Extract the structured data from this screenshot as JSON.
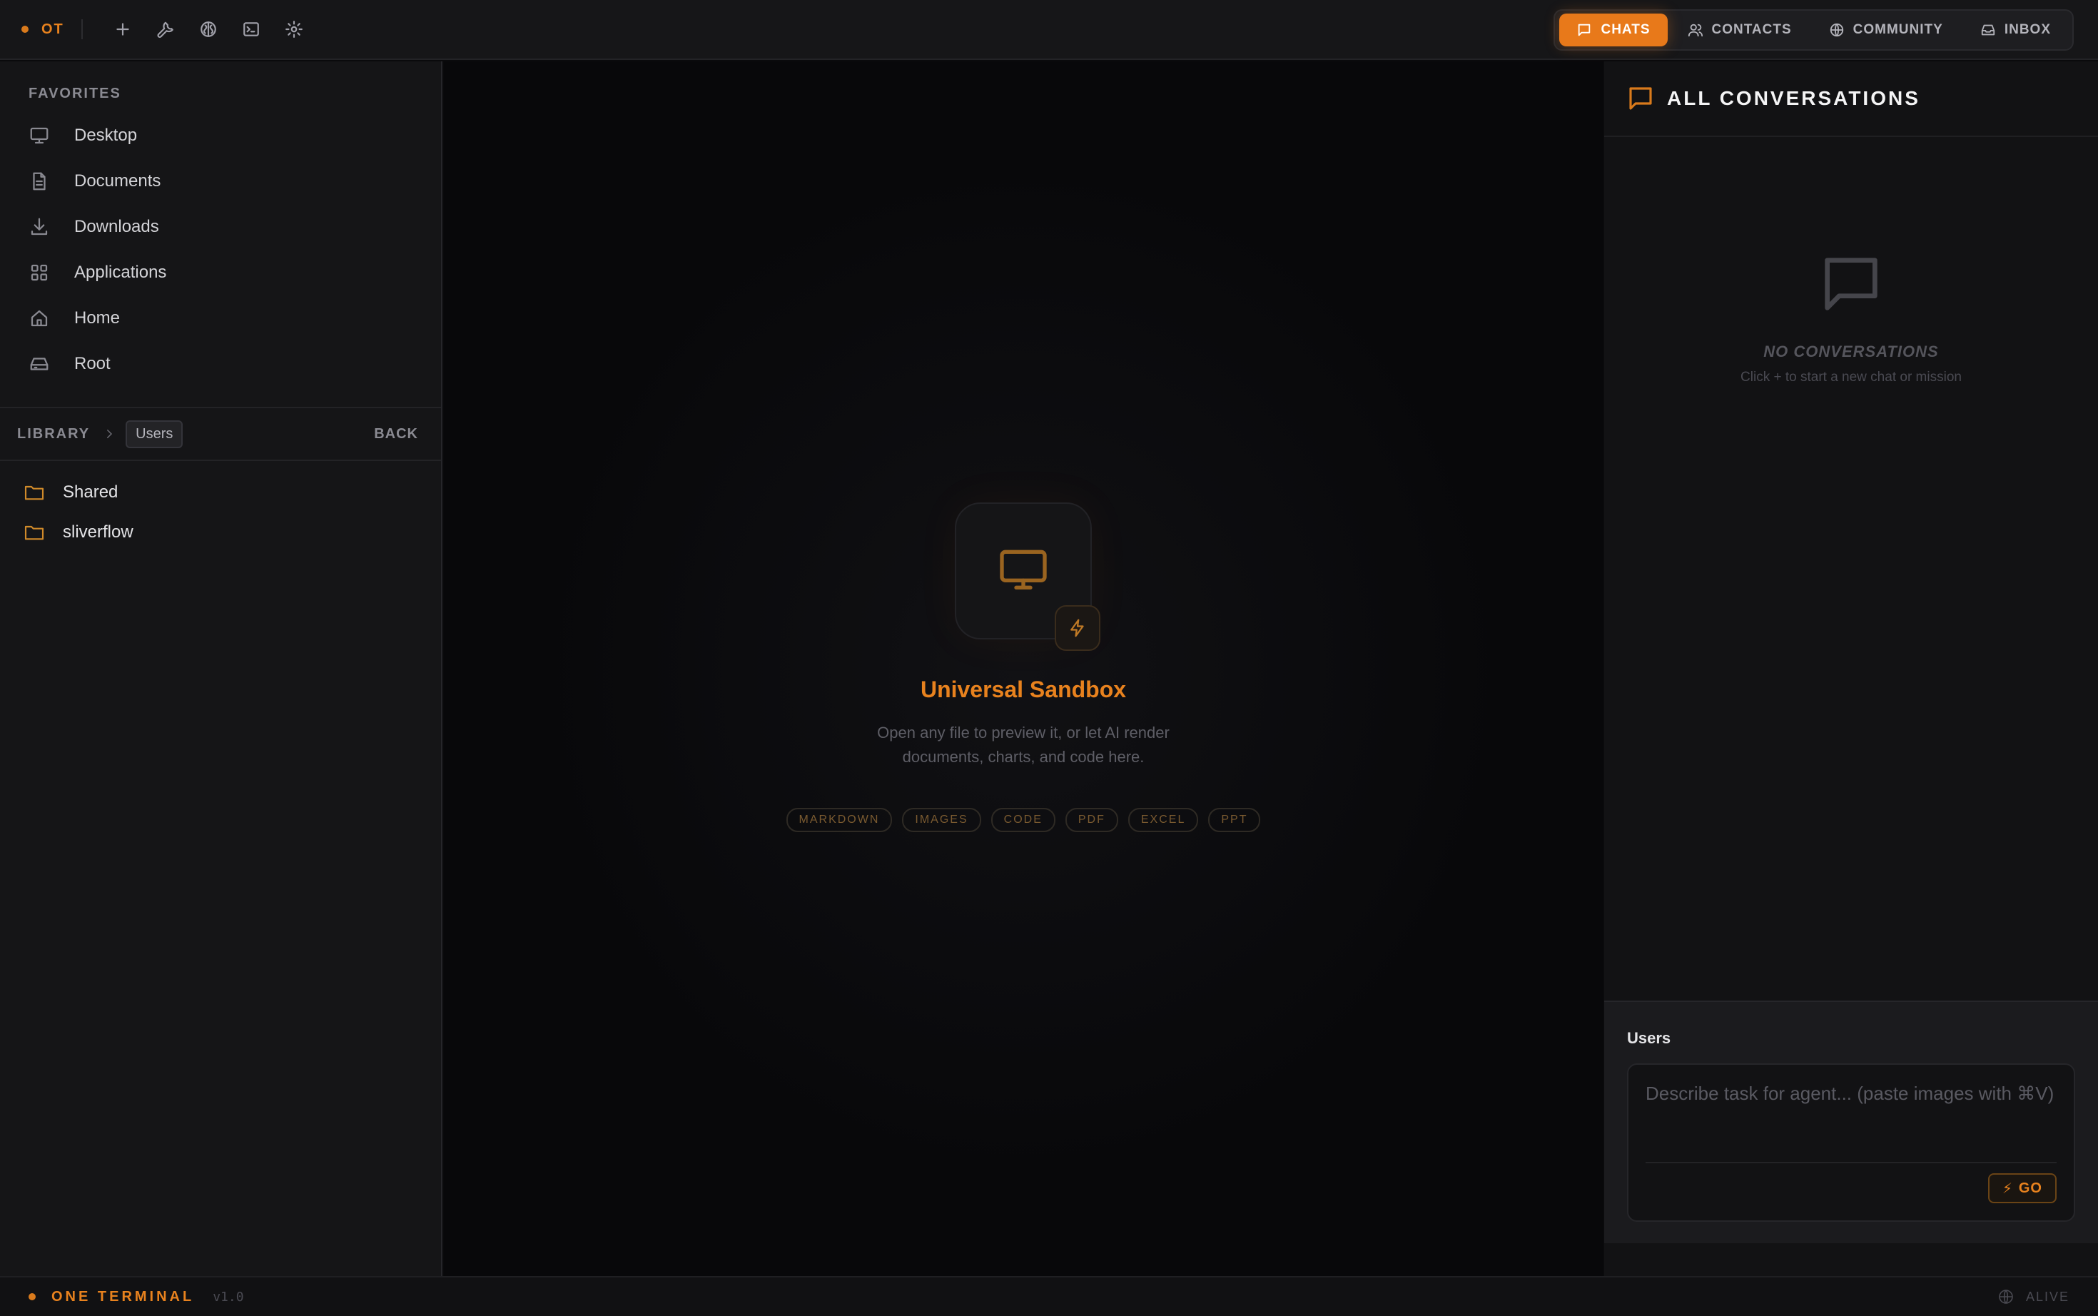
{
  "app": {
    "brand": "OT",
    "name": "ONE TERMINAL",
    "version": "v1.0"
  },
  "toolbar": {
    "icons": [
      "plus-icon",
      "wrench-icon",
      "brain-icon",
      "terminal-icon",
      "gear-icon"
    ]
  },
  "nav": {
    "tabs": [
      {
        "label": "CHATS",
        "icon": "chat-icon",
        "active": true
      },
      {
        "label": "CONTACTS",
        "icon": "users-icon",
        "active": false
      },
      {
        "label": "COMMUNITY",
        "icon": "globe-icon",
        "active": false
      },
      {
        "label": "INBOX",
        "icon": "inbox-icon",
        "active": false
      }
    ]
  },
  "sidebar": {
    "favorites_title": "FAVORITES",
    "favorites": [
      {
        "label": "Desktop",
        "icon": "monitor-icon"
      },
      {
        "label": "Documents",
        "icon": "document-icon"
      },
      {
        "label": "Downloads",
        "icon": "download-icon"
      },
      {
        "label": "Applications",
        "icon": "grid-icon"
      },
      {
        "label": "Home",
        "icon": "home-icon"
      },
      {
        "label": "Root",
        "icon": "drive-icon"
      }
    ],
    "library": {
      "label": "LIBRARY",
      "crumb": "Users",
      "back": "BACK"
    },
    "folders": [
      {
        "label": "Shared"
      },
      {
        "label": "sliverflow"
      }
    ]
  },
  "sandbox": {
    "title": "Universal Sandbox",
    "description": "Open any file to preview it, or let AI render documents, charts, and code here.",
    "tags": [
      "MARKDOWN",
      "IMAGES",
      "CODE",
      "PDF",
      "EXCEL",
      "PPT"
    ]
  },
  "conversations": {
    "title": "ALL CONVERSATIONS",
    "empty_title": "NO CONVERSATIONS",
    "empty_sub": "Click + to start a new chat or mission"
  },
  "composer": {
    "label": "Users",
    "placeholder": "Describe task for agent... (paste images with ⌘V)",
    "value": "",
    "go": "GO"
  },
  "status": {
    "right": "ALIVE"
  },
  "colors": {
    "accent": "#e8791a",
    "background": "#0a0a0c",
    "panel": "#151517"
  }
}
